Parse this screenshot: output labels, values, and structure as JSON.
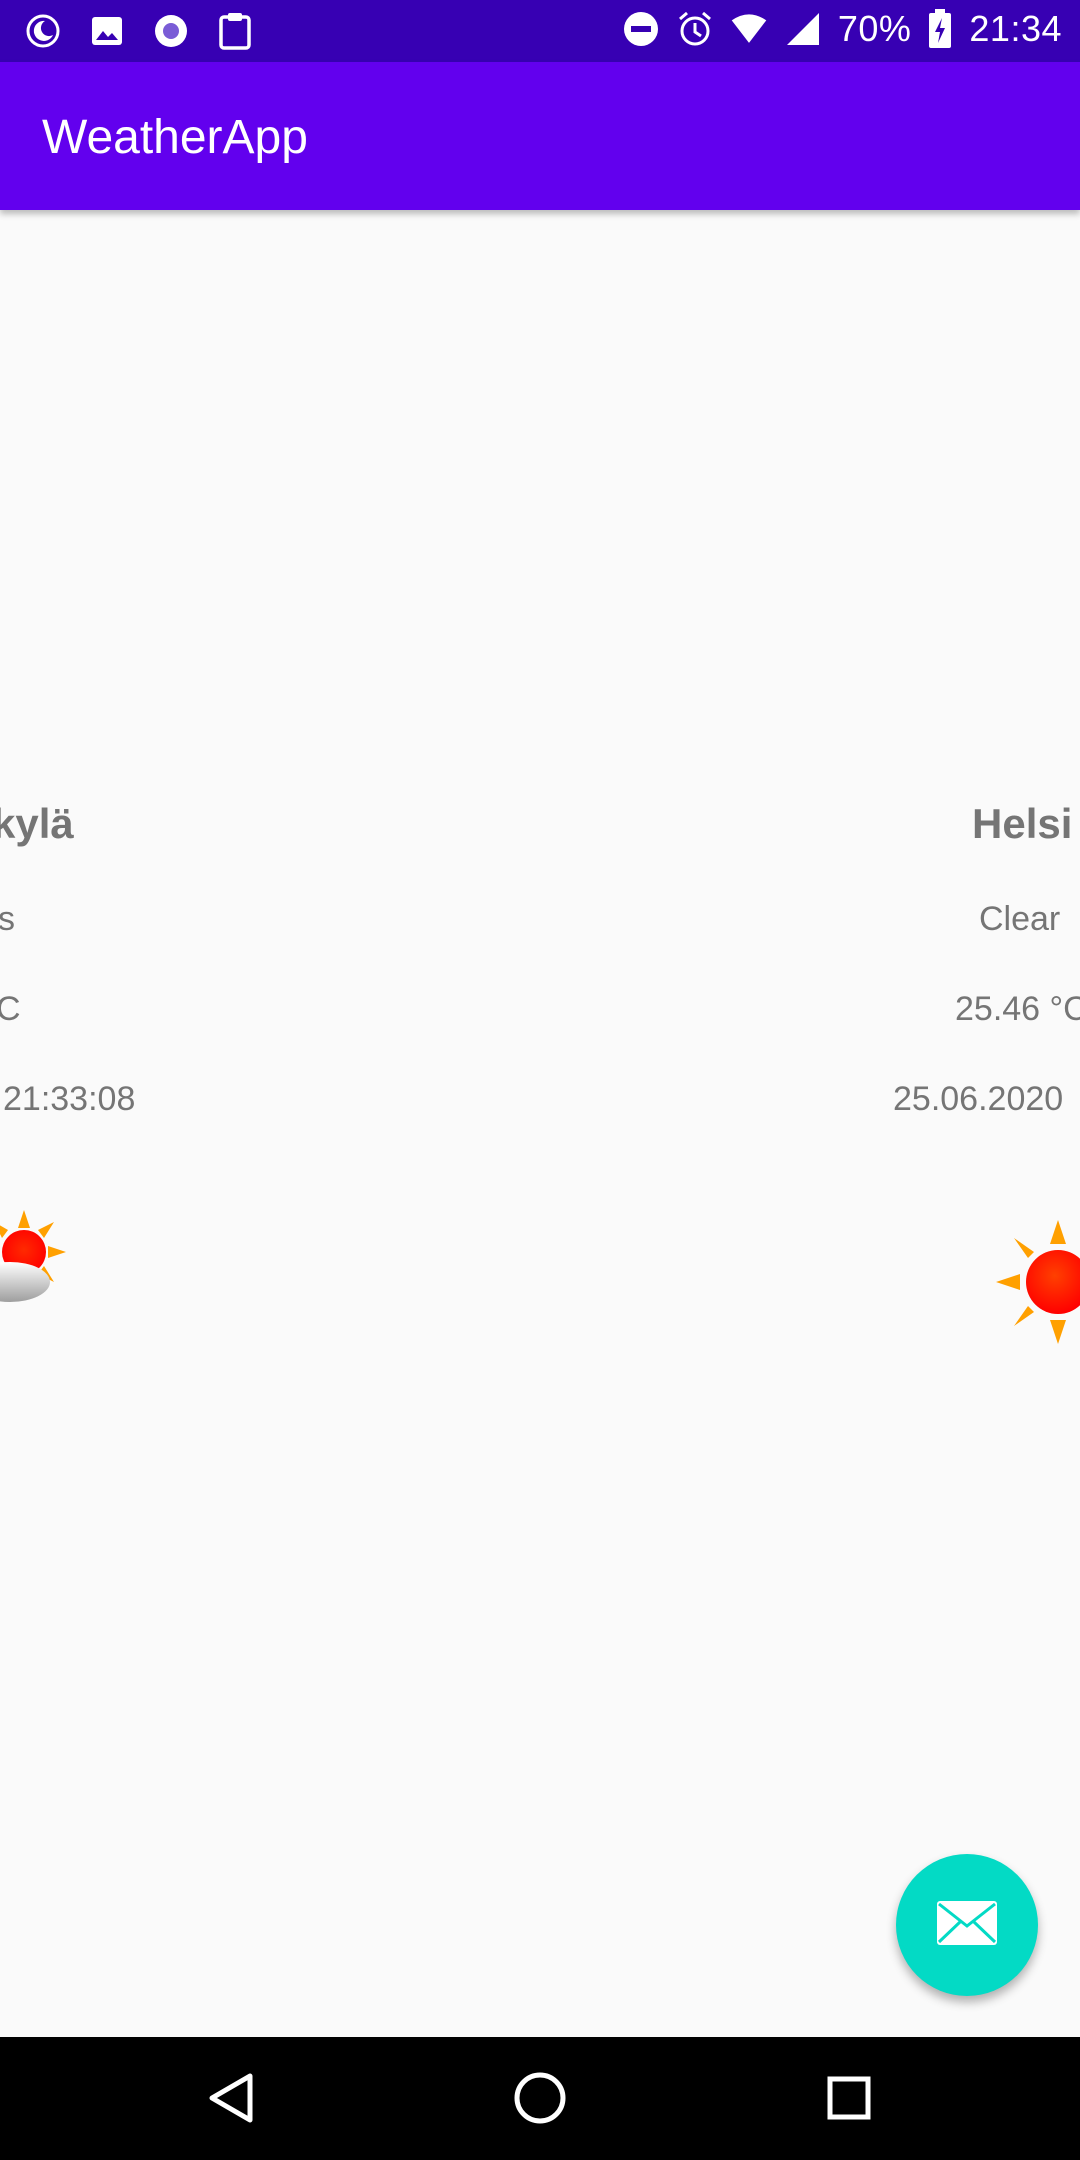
{
  "status_bar": {
    "battery": "70%",
    "time": "21:34",
    "icons_left": [
      "moon-icon",
      "image-icon",
      "radio-icon",
      "clipboard-icon"
    ],
    "icons_right": [
      "do-not-disturb-icon",
      "alarm-icon",
      "wifi-icon",
      "signal-icon",
      "battery-charging-icon"
    ]
  },
  "app_bar": {
    "title": "WeatherApp"
  },
  "cards": [
    {
      "city": "kylä",
      "description": "s",
      "temperature": "C",
      "timestamp": "21:33:08",
      "icon": "partly-cloudy-icon"
    },
    {
      "city": "Helsi",
      "description": "Clear",
      "temperature": "25.46 °C",
      "timestamp": "25.06.2020",
      "icon": "sun-icon"
    }
  ],
  "fab": {
    "icon": "mail-icon"
  },
  "nav_bar": {
    "buttons": [
      "back-icon",
      "home-icon",
      "recents-icon"
    ]
  },
  "colors": {
    "status_bar": "#3700b3",
    "app_bar": "#6200ee",
    "fab": "#03dac5",
    "text_secondary": "#757575",
    "background": "#fafafa"
  }
}
